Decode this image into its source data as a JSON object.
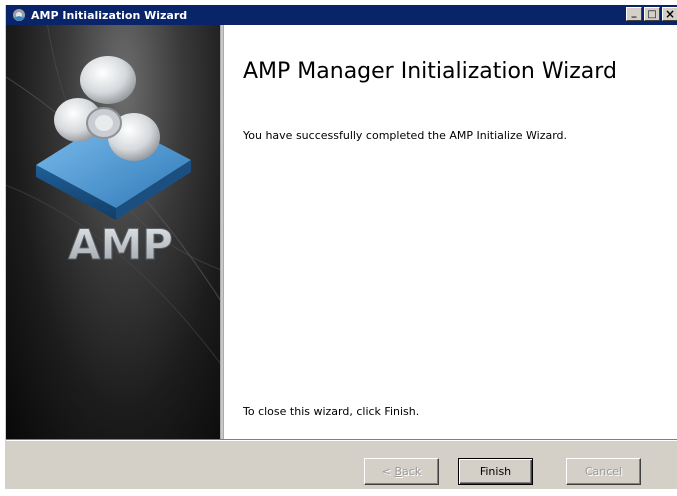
{
  "window": {
    "title": "AMP Initialization Wizard",
    "controls": {
      "minimize": "_",
      "maximize": "□",
      "close": "×"
    }
  },
  "side_panel": {
    "logo_text": "AMP",
    "logo_icon": "amp-3d-logo-icon"
  },
  "content": {
    "heading": "AMP Manager Initialization Wizard",
    "message": "You have successfully completed the AMP Initialize Wizard.",
    "close_instruction": "To close this wizard, click Finish."
  },
  "buttons": {
    "back_prefix": "< ",
    "back_mnemonic": "B",
    "back_rest": "ack",
    "finish": "Finish",
    "cancel": "Cancel"
  },
  "colors": {
    "titlebar": "#0a246a",
    "button_face": "#d4d0c8",
    "logo_blue": "#3a86c4"
  }
}
